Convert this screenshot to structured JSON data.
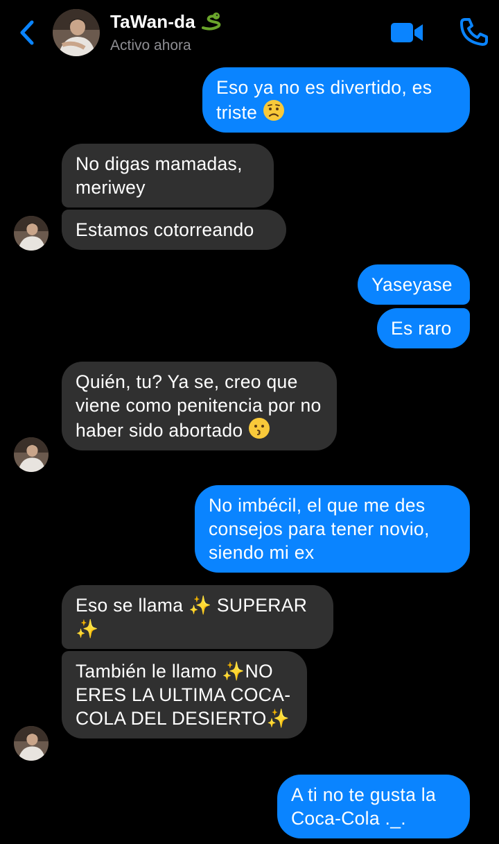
{
  "header": {
    "contact_name": "TaWan-da",
    "name_emoji": "snake-emoji",
    "status": "Activo ahora",
    "accent_color": "#0a84ff"
  },
  "messages": [
    {
      "side": "out",
      "text": "Eso ya no es divertido, es triste",
      "emoji": "worried-face"
    },
    {
      "side": "in",
      "text": "No digas mamadas, meriwey"
    },
    {
      "side": "in",
      "text": "Estamos cotorreando"
    },
    {
      "side": "out",
      "text": "Yaseyase"
    },
    {
      "side": "out",
      "text": "Es raro"
    },
    {
      "side": "in",
      "text": "Quién, tu? Ya se, creo que viene como penitencia por no haber sido abortado",
      "emoji": "kissing-face"
    },
    {
      "side": "out",
      "text": "No imbécil, el que me des consejos para tener novio, siendo mi ex"
    },
    {
      "side": "in",
      "text": "Eso se llama ✨ SUPERAR ✨"
    },
    {
      "side": "in",
      "text": "También le llamo ✨NO ERES LA ULTIMA COCA-COLA DEL DESIERTO✨"
    },
    {
      "side": "out",
      "text": "A ti no te gusta la Coca-Cola ._."
    }
  ],
  "colors": {
    "outgoing_bubble": "#0a84ff",
    "incoming_bubble": "#303030",
    "background": "#000000"
  }
}
